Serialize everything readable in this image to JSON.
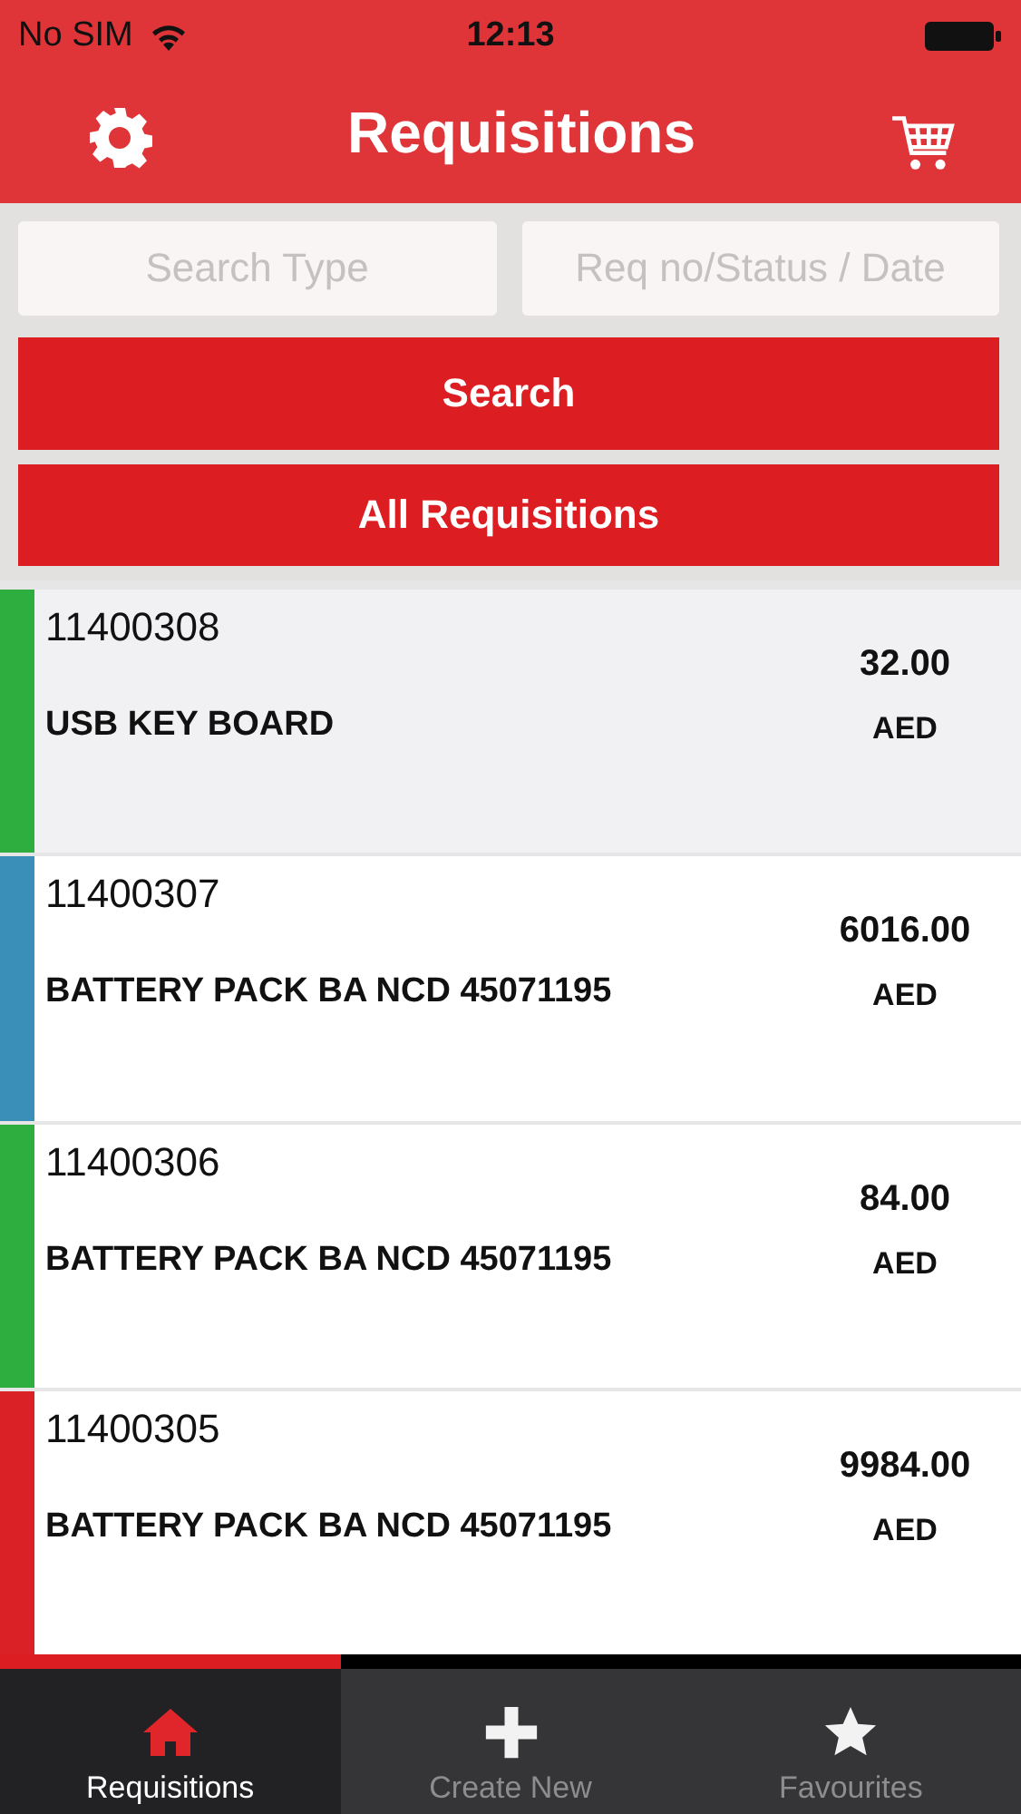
{
  "status_bar": {
    "carrier": "No SIM",
    "time": "12:13"
  },
  "nav": {
    "title": "Requisitions"
  },
  "search": {
    "type_placeholder": "Search Type",
    "query_placeholder": "Req no/Status / Date",
    "buttons": [
      "Search",
      "All Requisitions"
    ]
  },
  "requisitions": [
    {
      "number": "11400308",
      "description": "USB KEY BOARD",
      "amount": "32.00",
      "currency": "AED",
      "color": "#2eae3e",
      "selected": true
    },
    {
      "number": "11400307",
      "description": "BATTERY PACK BA NCD 45071195",
      "amount": "6016.00",
      "currency": "AED",
      "color": "#3a8fb8",
      "selected": false
    },
    {
      "number": "11400306",
      "description": "BATTERY PACK BA NCD 45071195",
      "amount": "84.00",
      "currency": "AED",
      "color": "#2eae3e",
      "selected": false
    },
    {
      "number": "11400305",
      "description": "BATTERY PACK BA NCD 45071195",
      "amount": "9984.00",
      "currency": "AED",
      "color": "#d92126",
      "selected": false
    }
  ],
  "tabs": [
    {
      "label": "Requisitions",
      "kind": "home",
      "selected": true
    },
    {
      "label": "Create New",
      "kind": "plus",
      "selected": false
    },
    {
      "label": "Favourites",
      "kind": "star",
      "selected": false
    }
  ]
}
